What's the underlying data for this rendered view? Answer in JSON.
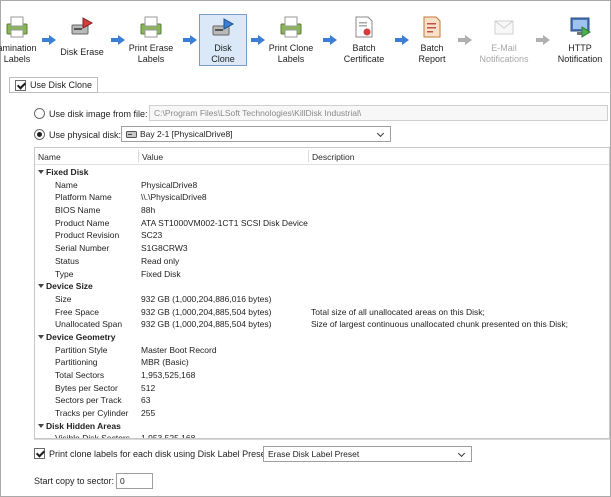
{
  "pipeline": {
    "steps": [
      {
        "label": "Examination\nLabels",
        "visible_label": "amination\nLabels",
        "icon": "label-printer-icon"
      },
      {
        "label": "Disk Erase",
        "icon": "disk-erase-icon"
      },
      {
        "label": "Print Erase\nLabels",
        "icon": "label-printer-icon"
      },
      {
        "label": "Disk\nClone",
        "icon": "disk-clone-icon",
        "active": true
      },
      {
        "label": "Print Clone\nLabels",
        "icon": "label-printer-icon"
      },
      {
        "label": "Batch\nCertificate",
        "icon": "certificate-icon"
      },
      {
        "label": "Batch\nReport",
        "icon": "report-icon"
      },
      {
        "label": "E-Mail\nNotifications",
        "icon": "email-icon",
        "disabled": true
      },
      {
        "label": "HTTP\nNotification",
        "icon": "http-notification-icon"
      }
    ]
  },
  "clone": {
    "use_disk_clone_label": "Use Disk Clone",
    "use_disk_clone_checked": true,
    "image_option_label": "Use disk image from file:",
    "image_path": "C:\\Program Files\\LSoft Technologies\\KillDisk Industrial\\",
    "physical_option_label": "Use physical disk:",
    "physical_selected": true,
    "physical_disk": "Bay 2-1 [PhysicalDrive8]"
  },
  "grid": {
    "columns": {
      "name": "Name",
      "value": "Value",
      "description": "Description"
    },
    "rows": [
      {
        "type": "cat",
        "name": "Fixed Disk"
      },
      {
        "name": "Name",
        "value": "PhysicalDrive8",
        "desc": ""
      },
      {
        "name": "Platform Name",
        "value": "\\\\.\\PhysicalDrive8",
        "desc": ""
      },
      {
        "name": "BIOS Name",
        "value": "88h",
        "desc": ""
      },
      {
        "name": "Product Name",
        "value": "ATA ST1000VM002-1CT1 SCSI Disk Device",
        "desc": ""
      },
      {
        "name": "Product Revision",
        "value": "SC23",
        "desc": ""
      },
      {
        "name": "Serial Number",
        "value": "S1G8CRW3",
        "desc": ""
      },
      {
        "name": "Status",
        "value": "Read only",
        "desc": ""
      },
      {
        "name": "Type",
        "value": "Fixed Disk",
        "desc": ""
      },
      {
        "type": "cat",
        "name": "Device Size"
      },
      {
        "name": "Size",
        "value": "932 GB (1,000,204,886,016 bytes)",
        "desc": ""
      },
      {
        "name": "Free Space",
        "value": "932 GB (1,000,204,885,504 bytes)",
        "desc": "Total size of all unallocated areas on this Disk;"
      },
      {
        "name": "Unallocated Span",
        "value": "932 GB (1,000,204,885,504 bytes)",
        "desc": "Size of largest continuous unallocated chunk presented on this Disk;"
      },
      {
        "type": "cat",
        "name": "Device Geometry"
      },
      {
        "name": "Partition Style",
        "value": "Master Boot Record",
        "desc": ""
      },
      {
        "name": "Partitioning",
        "value": "MBR (Basic)",
        "desc": ""
      },
      {
        "name": "Total Sectors",
        "value": "1,953,525,168",
        "desc": ""
      },
      {
        "name": "Bytes per Sector",
        "value": "512",
        "desc": ""
      },
      {
        "name": "Sectors per Track",
        "value": "63",
        "desc": ""
      },
      {
        "name": "Tracks per Cylinder",
        "value": "255",
        "desc": ""
      },
      {
        "type": "cat",
        "name": "Disk Hidden Areas"
      },
      {
        "name": "Visible Disk Sectors",
        "value": "1,953,525,168",
        "desc": ""
      }
    ]
  },
  "print_labels": {
    "label": "Print clone labels for each disk using Disk Label Preset:",
    "checked": true,
    "preset": "Erase Disk Label Preset"
  },
  "start_copy": {
    "label": "Start copy to sector:",
    "value": "0"
  }
}
